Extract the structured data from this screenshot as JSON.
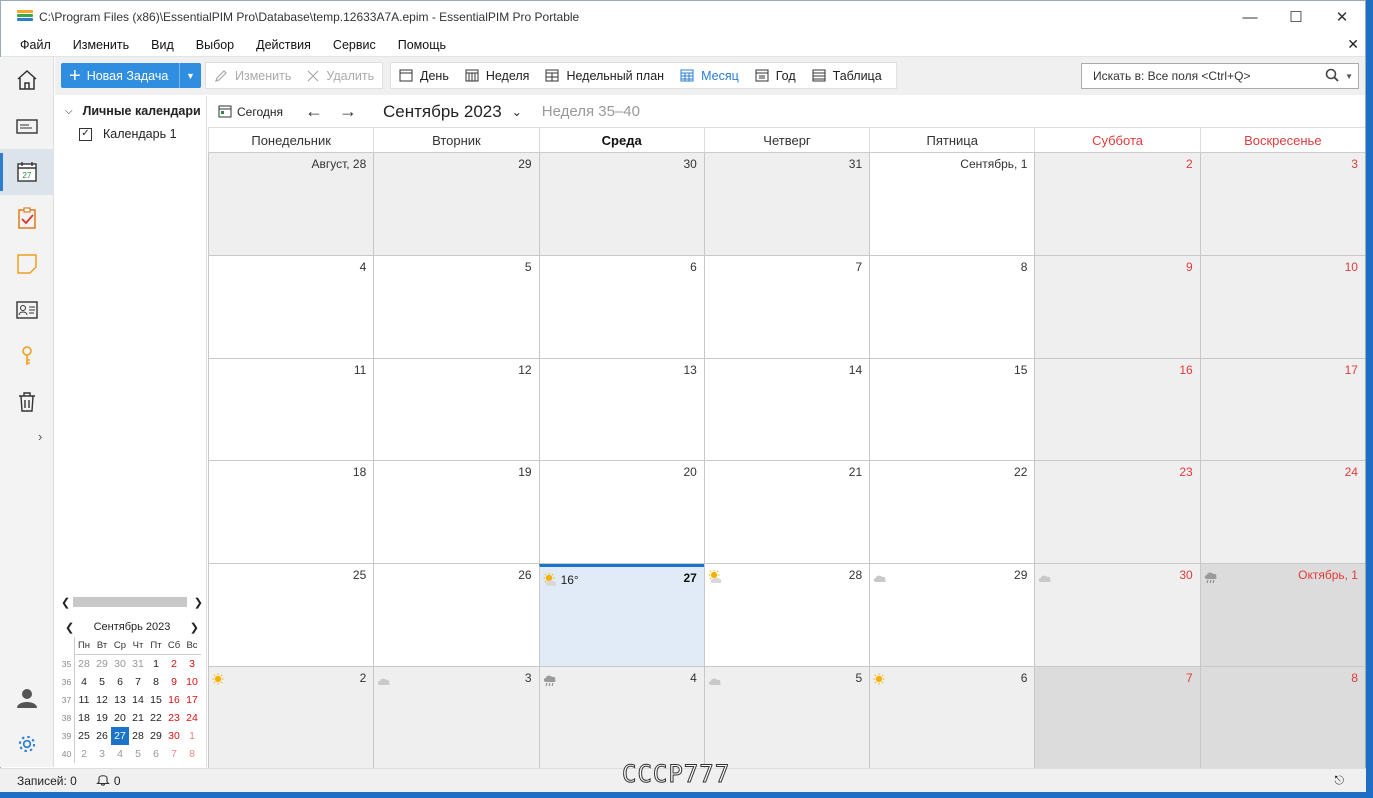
{
  "window": {
    "title": "C:\\Program Files (x86)\\EssentialPIM Pro\\Database\\temp.12633A7A.epim - EssentialPIM Pro Portable"
  },
  "menu": [
    "Файл",
    "Изменить",
    "Вид",
    "Выбор",
    "Действия",
    "Сервис",
    "Помощь"
  ],
  "toolbar": {
    "new_task": "Новая Задача",
    "edit": "Изменить",
    "delete": "Удалить",
    "views": [
      "День",
      "Неделя",
      "Недельный план",
      "Месяц",
      "Год",
      "Таблица"
    ],
    "active_view": "Месяц",
    "search_placeholder": "Искать в: Все поля  <Ctrl+Q>"
  },
  "sidebar": {
    "root": "Личные календари",
    "calendars": [
      {
        "label": "Календарь 1",
        "checked": true
      }
    ]
  },
  "minical": {
    "title": "Сентябрь  2023",
    "dow": [
      "Пн",
      "Вт",
      "Ср",
      "Чт",
      "Пт",
      "Сб",
      "Вс"
    ],
    "weeks": [
      {
        "num": "35",
        "days": [
          "28",
          "29",
          "30",
          "31",
          "1",
          "2",
          "3"
        ]
      },
      {
        "num": "36",
        "days": [
          "4",
          "5",
          "6",
          "7",
          "8",
          "9",
          "10"
        ]
      },
      {
        "num": "37",
        "days": [
          "11",
          "12",
          "13",
          "14",
          "15",
          "16",
          "17"
        ]
      },
      {
        "num": "38",
        "days": [
          "18",
          "19",
          "20",
          "21",
          "22",
          "23",
          "24"
        ]
      },
      {
        "num": "39",
        "days": [
          "25",
          "26",
          "27",
          "28",
          "29",
          "30",
          "1"
        ]
      },
      {
        "num": "40",
        "days": [
          "2",
          "3",
          "4",
          "5",
          "6",
          "7",
          "8"
        ]
      }
    ],
    "selected": "27"
  },
  "calendar": {
    "today_button": "Сегодня",
    "month_title": "Сентябрь 2023",
    "week_range": "Неделя 35–40",
    "dow": [
      "Понедельник",
      "Вторник",
      "Среда",
      "Четверг",
      "Пятница",
      "Суббота",
      "Воскресенье"
    ],
    "weeks": [
      [
        "Август, 28",
        "29",
        "30",
        "31",
        "Сентябрь, 1",
        "2",
        "3"
      ],
      [
        "4",
        "5",
        "6",
        "7",
        "8",
        "9",
        "10"
      ],
      [
        "11",
        "12",
        "13",
        "14",
        "15",
        "16",
        "17"
      ],
      [
        "18",
        "19",
        "20",
        "21",
        "22",
        "23",
        "24"
      ],
      [
        "25",
        "26",
        "27",
        "28",
        "29",
        "30",
        "Октябрь, 1"
      ],
      [
        "2",
        "3",
        "4",
        "5",
        "6",
        "7",
        "8"
      ]
    ],
    "today_temp": "16°",
    "weather": {
      "4-2": "sun-cloud",
      "4-3": "sun-cloud",
      "4-4": "cloud",
      "4-5": "cloud",
      "4-6": "rain-cloud",
      "5-0": "sun",
      "5-1": "cloud",
      "5-2": "rain-cloud",
      "5-3": "cloud",
      "5-4": "sun"
    }
  },
  "status": {
    "records": "Записей: 0",
    "alerts": "0"
  },
  "watermark": "CCCP777",
  "colors": {
    "accent": "#2b7cd3",
    "weekend": "#e23b3b",
    "today_bg": "#e0ebf7"
  }
}
